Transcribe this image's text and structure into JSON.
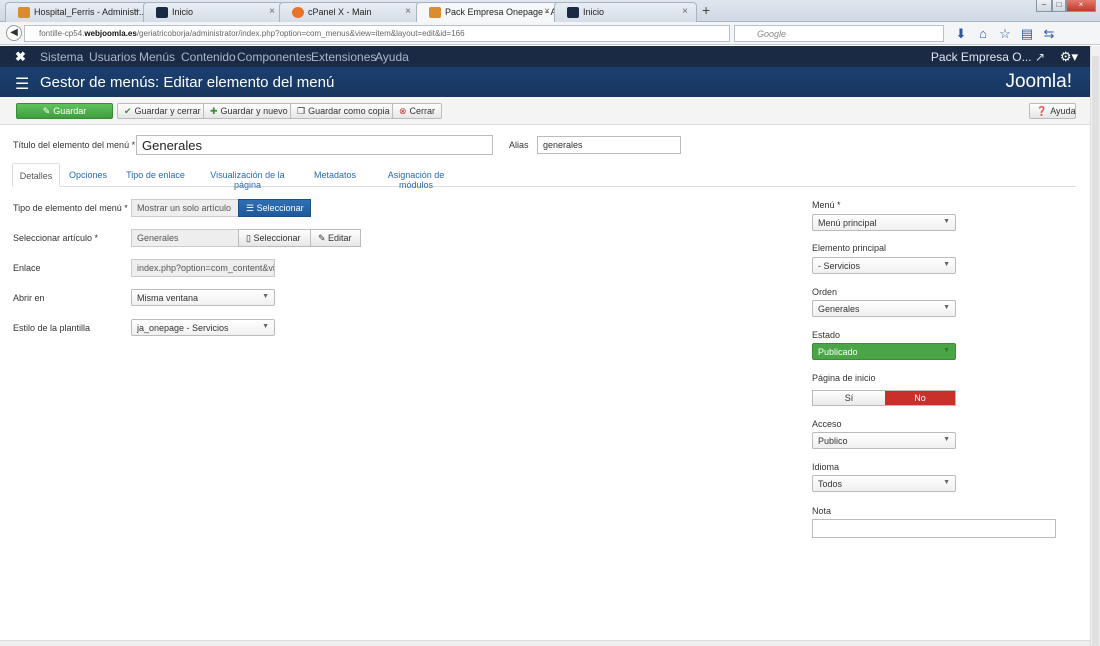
{
  "browser": {
    "tabs": [
      {
        "label": "Hospital_Ferris - Administr...",
        "favicon_color": "#d98d2f"
      },
      {
        "label": "Inicio",
        "favicon_color": "#1b2a44"
      },
      {
        "label": "cPanel X - Main",
        "favicon_color": "#e8742a"
      },
      {
        "label": "Pack Empresa Onepage - A...",
        "favicon_color": "#d98d2f"
      },
      {
        "label": "Inicio",
        "favicon_color": "#1b2a44"
      }
    ],
    "url_prefix": "fontille-cp54.",
    "url_domain": "webjoomla.es",
    "url_path": "/geriatricoborja/administrator/index.php?option=com_menus&view=item&layout=edit&id=166",
    "search_placeholder": "Google"
  },
  "topmenu": {
    "items": [
      "Sistema",
      "Usuarios",
      "Menús",
      "Contenido",
      "Componentes",
      "Extensiones",
      "Ayuda"
    ],
    "site_name": "Pack Empresa O..."
  },
  "header": {
    "title": "Gestor de menús: Editar elemento del menú",
    "brand": "Joomla!"
  },
  "toolbar": {
    "save": "Guardar",
    "save_close": "Guardar y cerrar",
    "save_new": "Guardar y nuevo",
    "save_copy": "Guardar como copia",
    "close": "Cerrar",
    "help": "Ayuda"
  },
  "form": {
    "title_label": "Título del elemento del menú *",
    "title_value": "Generales",
    "alias_label": "Alias",
    "alias_value": "generales",
    "tabs": [
      "Detalles",
      "Opciones",
      "Tipo de enlace",
      "Visualización de la página",
      "Metadatos",
      "Asignación de módulos"
    ],
    "type_label": "Tipo de elemento del menú *",
    "type_value": "Mostrar un solo artículo",
    "type_button": "Seleccionar",
    "article_label": "Seleccionar artículo *",
    "article_value": "Generales",
    "article_select": "Seleccionar",
    "article_edit": "Editar",
    "link_label": "Enlace",
    "link_value": "index.php?option=com_content&view",
    "open_label": "Abrir en",
    "open_value": "Misma ventana",
    "style_label": "Estilo de la plantilla",
    "style_value": "ja_onepage - Servicios"
  },
  "sidebar": {
    "menu_label": "Menú *",
    "menu_value": "Menú principal",
    "parent_label": "Elemento principal",
    "parent_value": "- Servicios",
    "order_label": "Orden",
    "order_value": "Generales",
    "status_label": "Estado",
    "status_value": "Publicado",
    "home_label": "Página de inicio",
    "home_yes": "Sí",
    "home_no": "No",
    "access_label": "Acceso",
    "access_value": "Publico",
    "language_label": "Idioma",
    "language_value": "Todos",
    "note_label": "Nota",
    "note_value": ""
  }
}
